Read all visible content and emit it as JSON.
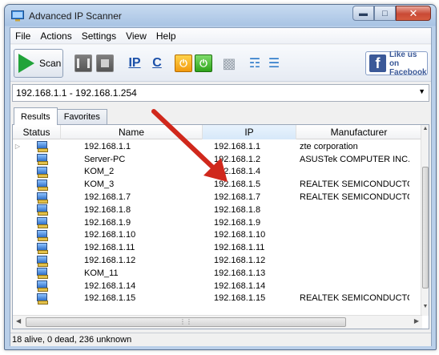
{
  "window": {
    "title": "Advanced IP Scanner"
  },
  "menu": [
    "File",
    "Actions",
    "Settings",
    "View",
    "Help"
  ],
  "toolbar": {
    "scan_label": "Scan",
    "ip_label": "IP",
    "c_label": "C",
    "fb_line1": "Like us on",
    "fb_line2": "Facebook"
  },
  "range": {
    "value": "192.168.1.1 - 192.168.1.254"
  },
  "tabs": [
    "Results",
    "Favorites"
  ],
  "columns": {
    "status": "Status",
    "name": "Name",
    "ip": "IP",
    "manufacturer": "Manufacturer"
  },
  "rows": [
    {
      "name": "192.168.1.1",
      "ip": "192.168.1.1",
      "manufacturer": "zte corporation"
    },
    {
      "name": "Server-PC",
      "ip": "192.168.1.2",
      "manufacturer": "ASUSTek COMPUTER INC."
    },
    {
      "name": "KOM_2",
      "ip": "192.168.1.4",
      "manufacturer": ""
    },
    {
      "name": "KOM_3",
      "ip": "192.168.1.5",
      "manufacturer": "REALTEK SEMICONDUCTO"
    },
    {
      "name": "192.168.1.7",
      "ip": "192.168.1.7",
      "manufacturer": "REALTEK SEMICONDUCTO"
    },
    {
      "name": "192.168.1.8",
      "ip": "192.168.1.8",
      "manufacturer": ""
    },
    {
      "name": "192.168.1.9",
      "ip": "192.168.1.9",
      "manufacturer": ""
    },
    {
      "name": "192.168.1.10",
      "ip": "192.168.1.10",
      "manufacturer": ""
    },
    {
      "name": "192.168.1.11",
      "ip": "192.168.1.11",
      "manufacturer": ""
    },
    {
      "name": "192.168.1.12",
      "ip": "192.168.1.12",
      "manufacturer": ""
    },
    {
      "name": "KOM_11",
      "ip": "192.168.1.13",
      "manufacturer": ""
    },
    {
      "name": "192.168.1.14",
      "ip": "192.168.1.14",
      "manufacturer": ""
    },
    {
      "name": "192.168.1.15",
      "ip": "192.168.1.15",
      "manufacturer": "REALTEK SEMICONDUCTO"
    }
  ],
  "status": {
    "text": "18 alive, 0 dead, 236 unknown"
  },
  "colors": {
    "arrow": "#d0281c",
    "scan_green": "#21a33a",
    "facebook_blue": "#3b5998"
  }
}
